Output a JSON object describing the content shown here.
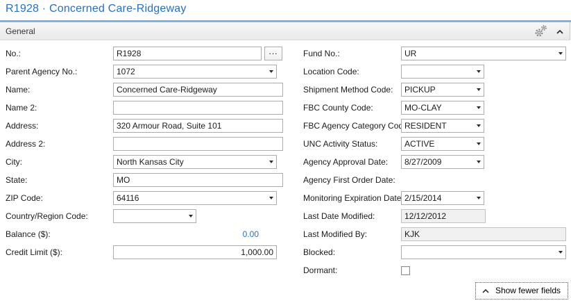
{
  "page": {
    "title": "R1928 · Concerned Care-Ridgeway"
  },
  "section": {
    "label": "General"
  },
  "icons": {
    "customize": "gears-icon",
    "collapse": "chevron-up-icon",
    "dropdown": "caret-down-icon",
    "show_fewer": "chevron-up-icon"
  },
  "colors": {
    "title_blue": "#2570c4",
    "accent_line_blue": "#7cb2e1",
    "link_blue": "#2570c4",
    "readonly_bg": "#f0f0f0",
    "field_border": "#ababab"
  },
  "fields": {
    "left": [
      {
        "label": "No.:",
        "value": "R1928",
        "type": "lookup",
        "lookup_button": "..."
      },
      {
        "label": "Parent Agency No.:",
        "value": "1072",
        "type": "dropdown"
      },
      {
        "label": "Name:",
        "value": "Concerned Care-Ridgeway",
        "type": "text"
      },
      {
        "label": "Name 2:",
        "value": "",
        "type": "text"
      },
      {
        "label": "Address:",
        "value": "320 Armour Road, Suite 101",
        "type": "text"
      },
      {
        "label": "Address 2:",
        "value": "",
        "type": "text"
      },
      {
        "label": "City:",
        "value": "North Kansas City",
        "type": "dropdown"
      },
      {
        "label": "State:",
        "value": "MO",
        "type": "text"
      },
      {
        "label": "ZIP Code:",
        "value": "64116",
        "type": "dropdown"
      },
      {
        "label": "Country/Region Code:",
        "value": "",
        "type": "dropdown-narrow"
      },
      {
        "label": "Balance ($):",
        "value": "0.00",
        "type": "balance-link"
      },
      {
        "label": "Credit Limit ($):",
        "value": "1,000.00",
        "type": "amount"
      }
    ],
    "right": [
      {
        "label": "Fund No.:",
        "value": "UR",
        "type": "dropdown-wide"
      },
      {
        "label": "Location Code:",
        "value": "",
        "type": "dropdown-narrow"
      },
      {
        "label": "Shipment Method Code:",
        "value": "PICKUP",
        "type": "dropdown-narrow"
      },
      {
        "label": "FBC County Code:",
        "value": "MO-CLAY",
        "type": "dropdown-narrow"
      },
      {
        "label": "FBC Agency Category Code:",
        "value": "RESIDENT",
        "type": "dropdown-narrow"
      },
      {
        "label": "UNC Activity Status:",
        "value": "ACTIVE",
        "type": "dropdown-narrow"
      },
      {
        "label": "Agency Approval Date:",
        "value": "8/27/2009",
        "type": "dropdown-narrow"
      },
      {
        "label": "Agency First Order Date:",
        "value": "",
        "type": "label-only"
      },
      {
        "label": "Monitoring Expiration Date:",
        "value": "2/15/2014",
        "type": "dropdown-narrow"
      },
      {
        "label": "Last Date Modified:",
        "value": "12/12/2012",
        "type": "readonly"
      },
      {
        "label": "Last Modified By:",
        "value": "KJK",
        "type": "readonly-wide"
      },
      {
        "label": "Blocked:",
        "value": "",
        "type": "dropdown-wide"
      },
      {
        "label": "Dormant:",
        "checked": false,
        "type": "checkbox"
      }
    ]
  },
  "footer": {
    "show_fewer_label": "Show fewer fields"
  }
}
